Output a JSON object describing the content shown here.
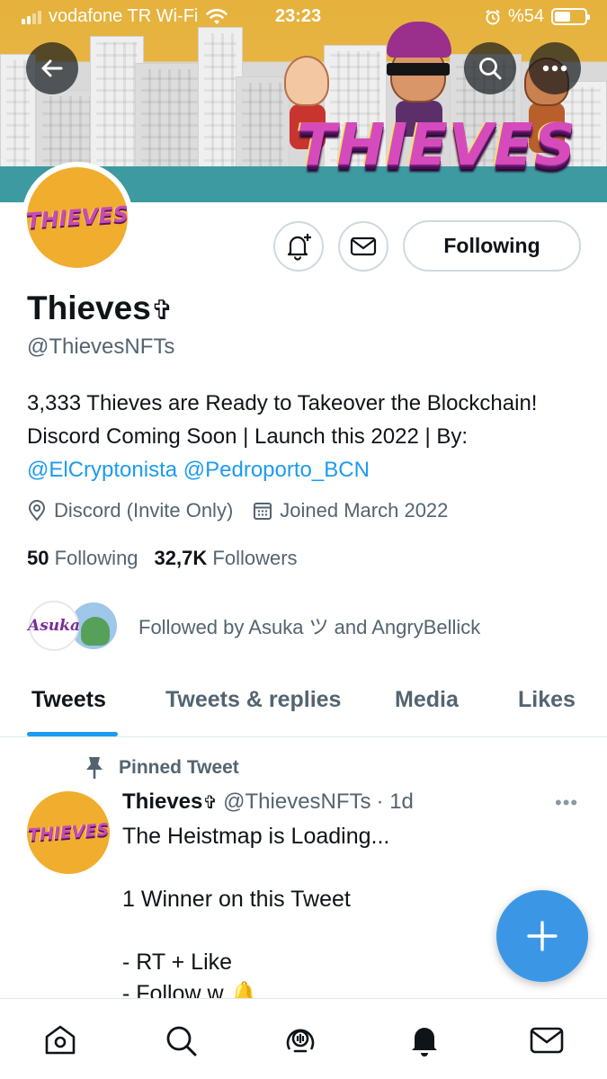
{
  "status_bar": {
    "carrier": "vodafone TR Wi-Fi",
    "time": "23:23",
    "battery": "%54",
    "battery_level": 0.54
  },
  "banner": {
    "logo_text": "THIEVES"
  },
  "header": {
    "back_icon": "arrow-left-icon",
    "search_icon": "search-icon",
    "more_icon": "more-horizontal-icon"
  },
  "profile": {
    "avatar_text": "THIEVES",
    "display_name": "Thieves",
    "name_glyph": "✞",
    "handle": "@ThievesNFTs",
    "bio_text": "3,333 Thieves are Ready to Takeover the Blockchain! Discord Coming Soon | Launch this 2022 | By: ",
    "bio_link_1": "@ElCryptonista",
    "bio_link_2": "@Pedroporto_BCN",
    "location": "Discord (Invite Only)",
    "joined": "Joined March 2022",
    "following_count": "50",
    "following_label": "Following",
    "followers_count": "32,7K",
    "followers_label": "Followers",
    "followed_by": "Followed by Asuka ツ and AngryBellick",
    "follower_avatar_1_text": "Asuka",
    "follow_button": "Following",
    "notify_icon": "bell-plus-icon",
    "message_icon": "envelope-icon"
  },
  "tabs": [
    {
      "label": "Tweets",
      "active": true
    },
    {
      "label": "Tweets & replies",
      "active": false
    },
    {
      "label": "Media",
      "active": false
    },
    {
      "label": "Likes",
      "active": false
    }
  ],
  "pinned_tweet": {
    "pinned_label": "Pinned Tweet",
    "author_name": "Thieves",
    "author_glyph": "✞",
    "author_handle": "@ThievesNFTs",
    "time_ago": "· 1d",
    "more": "•••",
    "lines": [
      "The Heistmap is Loading...",
      "",
      "1 Winner on this Tweet",
      "",
      "- RT + Like",
      "- Follow w 🔔"
    ]
  },
  "fab": {
    "icon": "plus-icon"
  },
  "bottom_nav": [
    "home-icon",
    "search-icon",
    "spaces-icon",
    "notifications-icon",
    "messages-icon"
  ],
  "colors": {
    "accent": "#1d9bf0",
    "fab": "#3b97e6",
    "secondary_text": "#536471",
    "avatar_bg": "#f0ad2e"
  }
}
